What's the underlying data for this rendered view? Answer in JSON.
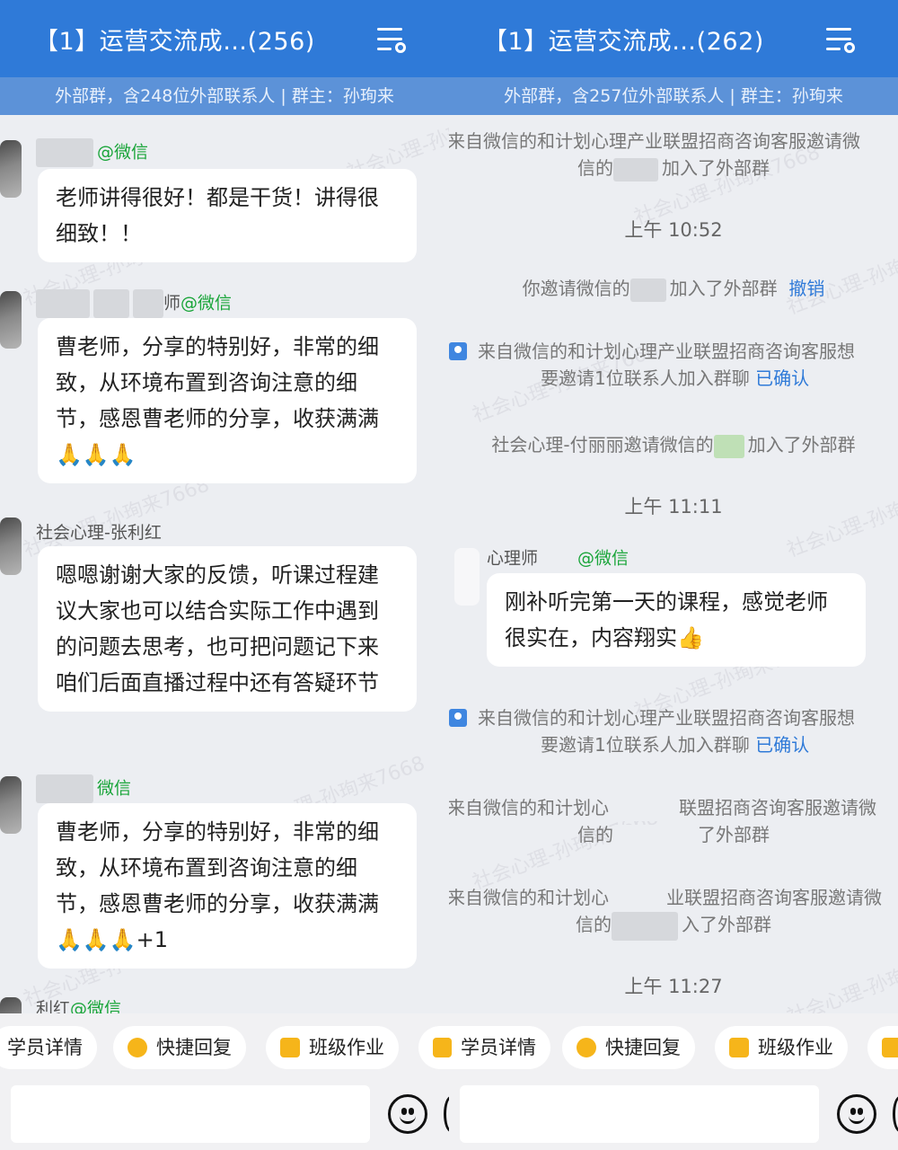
{
  "left": {
    "title": "【1】运营交流成…(256)",
    "subtitle": "外部群，含248位外部联系人 | 群主：孙珣来",
    "watermark": "社会心理-孙珣来7668",
    "messages": [
      {
        "sender_suffix": "@微信",
        "text": "老师讲得很好！都是干货！讲得很细致！！"
      },
      {
        "sender_suffix": "师",
        "sender_at": "@微信",
        "text": "曹老师，分享的特别好，非常的细致，从环境布置到咨询注意的细节，感恩曹老师的分享，收获满满🙏🙏🙏"
      },
      {
        "sender": "社会心理-张利红",
        "text": "嗯嗯谢谢大家的反馈，听课过程建议大家也可以结合实际工作中遇到的问题去思考，也可把问题记下来咱们后面直播过程中还有答疑环节"
      },
      {
        "sender_suffix": "微信",
        "text": "曹老师，分享的特别好，非常的细致，从环境布置到咨询注意的细节，感恩曹老师的分享，收获满满🙏🙏🙏+1"
      },
      {
        "sender_partial": "利红",
        "sender_at": "@微信"
      }
    ]
  },
  "right": {
    "title": "【1】运营交流成…(262)",
    "subtitle": "外部群，含257位外部联系人 | 群主：孙珣来",
    "items": [
      {
        "line1": "来自微信的和计划心理产业联盟招商咨询客服邀请微",
        "line2a": "信的",
        "line2b": "加入了外部群"
      },
      {
        "time": "上午 10:52"
      },
      {
        "text_a": "你邀请微信的",
        "text_b": "加入了外部群",
        "link": "撤销"
      },
      {
        "line1": "来自微信的和计划心理产业联盟招商咨询客服想",
        "line2": "要邀请1位联系人加入群聊",
        "link": "已确认"
      },
      {
        "text_a": "社会心理-付丽丽邀请微信的",
        "text_b": "加入了外部群"
      },
      {
        "time": "上午 11:11"
      },
      {
        "sender_prefix": "心理师",
        "sender_at": "@微信",
        "text": "刚补听完第一天的课程，感觉老师很实在，内容翔实👍"
      },
      {
        "line1": "来自微信的和计划心理产业联盟招商咨询客服想",
        "line2": "要邀请1位联系人加入群聊",
        "link": "已确认"
      },
      {
        "line1a": "来自微信的和计划心",
        "line1b": "联盟招商咨询客服邀请微",
        "line2a": "信的",
        "line2b": "了外部群"
      },
      {
        "line1a": "来自微信的和计划心",
        "line1b": "业联盟招商咨询客服邀请微",
        "line2a": "信的",
        "line2b": "入了外部群"
      },
      {
        "time": "上午 11:27"
      }
    ]
  },
  "quick_actions": [
    "学员详情",
    "快捷回复",
    "班级作业"
  ],
  "colors": {
    "header": "#2f7ad8",
    "subheader": "#5c92d8",
    "link": "#2f7ad8",
    "at": "#1aa53a",
    "chip_icon": "#f6b51a"
  }
}
